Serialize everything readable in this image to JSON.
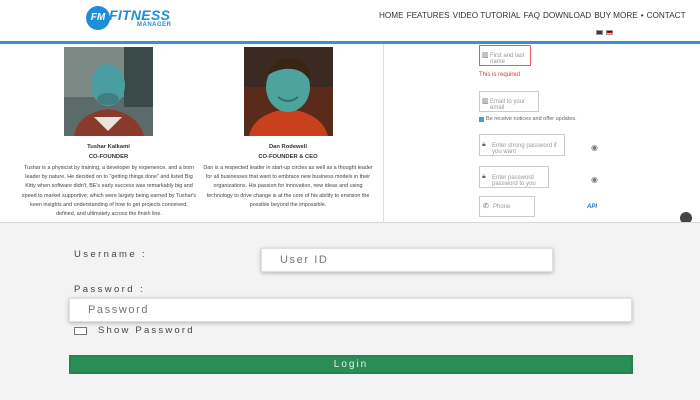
{
  "header": {
    "logo_badge": "FM",
    "logo_word": "FITNESS",
    "logo_sub": "MANAGER",
    "nav": [
      "HOME",
      "FEATURES",
      "VIDEO TUTORIAL",
      "FAQ",
      "DOWNLOAD",
      "BUY MORE",
      "CONTACT"
    ],
    "nav_separator": "•",
    "languages": [
      "gb-flag-icon",
      "de-flag-icon"
    ],
    "brand_color": "#1c8fd8"
  },
  "team": {
    "members": [
      {
        "name": "Tushar Kalkami",
        "role": "CO-FOUNDER",
        "bio": [
          "Tushar is a physicist by training, a developer by experience, and a born",
          "leader by nature. He decided on to \"getting things done\" and listed Big",
          "Kitty when software didn't, BE's early success was remarkably big and",
          "speed to market supportive; which were largely being earned by Tushar's",
          "keen insights and understanding of how to get projects conceived,",
          "defined, and ultimately across the finish line."
        ]
      },
      {
        "name": "Dan Rodewell",
        "role": "CO-FOUNDER & CEO",
        "bio": [
          "Dan is a respected leader in start-up circles as well as a thought leader",
          "for all businesses that want to embrace new business models in their",
          "organizations. His passion for innovation, new ideas and using",
          "technology to drive change is at the core of his ability to envision the",
          "possible beyond the impossible."
        ]
      }
    ]
  },
  "signup_form": {
    "name_placeholder": "First and last name",
    "name_error": "This is required",
    "email_placeholder": "Email to your email",
    "email_hint": "Be receive notices and offer updates.",
    "password_placeholder": "Enter strong password if you want",
    "confirm_placeholder": "Enter password password to you",
    "phone_placeholder": "Phone",
    "api_label": "API"
  },
  "login": {
    "username_label": "Username :",
    "username_placeholder": "User ID",
    "password_label": "Password :",
    "password_placeholder": "Password",
    "show_password_label": "Show Password",
    "show_password_checked": false,
    "login_button": "Login",
    "accent_color": "#2a8c57"
  }
}
